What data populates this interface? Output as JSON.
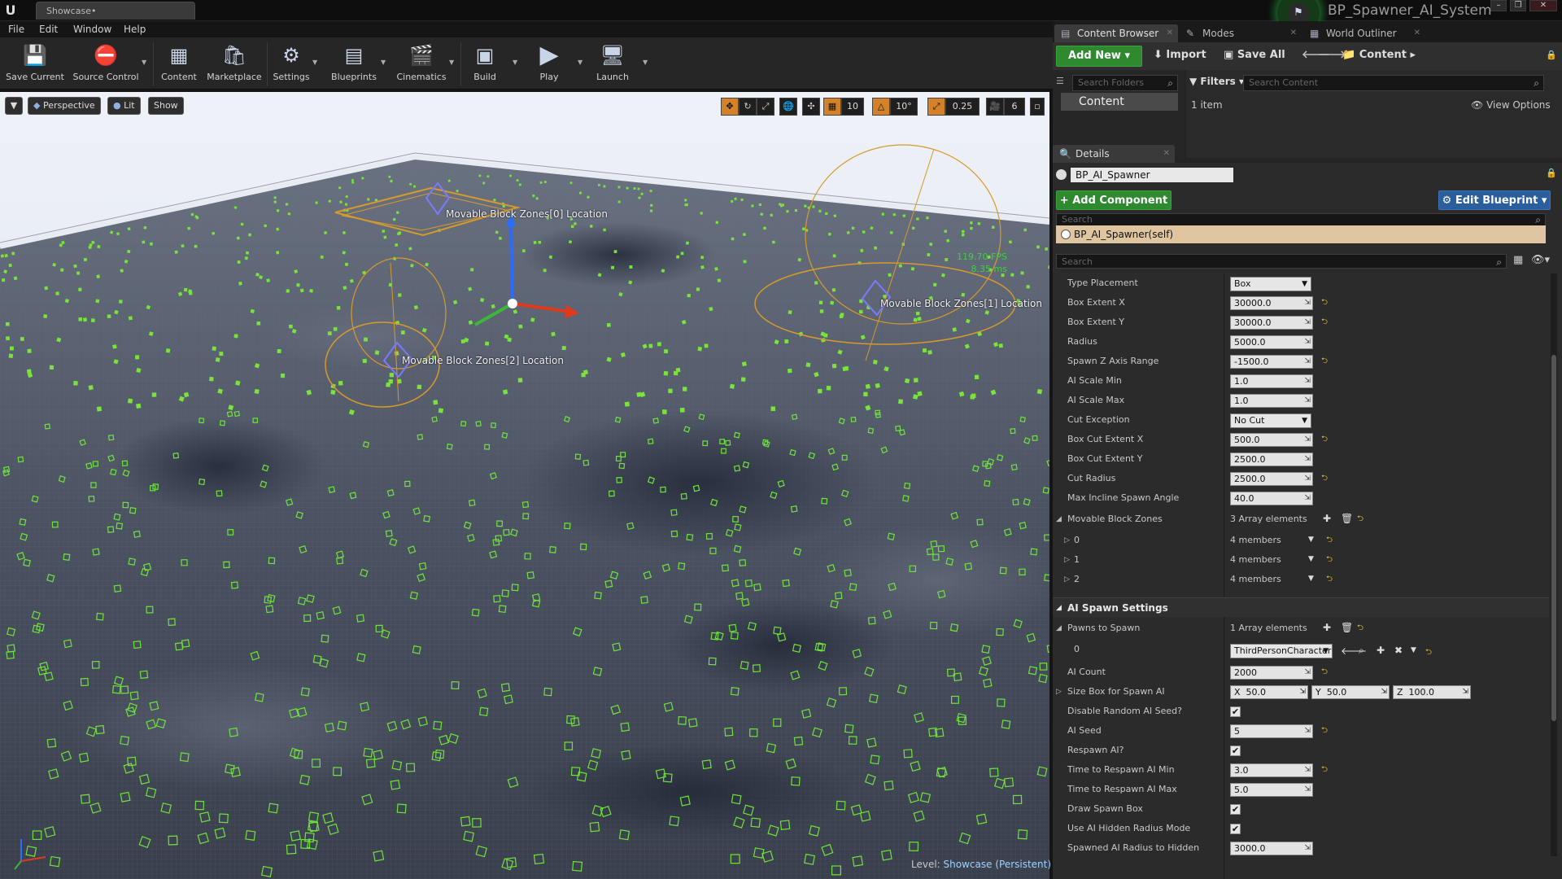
{
  "window": {
    "tab_title": "Showcase•",
    "project_name": "BP_Spawner_AI_System"
  },
  "menu": [
    "File",
    "Edit",
    "Window",
    "Help"
  ],
  "toolbar": {
    "save_current": "Save Current",
    "source_control": "Source Control",
    "content": "Content",
    "marketplace": "Marketplace",
    "settings": "Settings",
    "blueprints": "Blueprints",
    "cinematics": "Cinematics",
    "build": "Build",
    "play": "Play",
    "launch": "Launch"
  },
  "viewport": {
    "perspective": "Perspective",
    "lit": "Lit",
    "show": "Show",
    "grid_snap": "10",
    "rot_snap": "10°",
    "scale_snap": "0.25",
    "cam_speed": "6",
    "fps": "119.70 FPS",
    "ms": "8.35 ms",
    "labels": {
      "zone0": "Movable Block Zones[0] Location",
      "zone1": "Movable Block Zones[1] Location",
      "zone2": "Movable Block Zones[2] Location"
    },
    "level_label": "Level:",
    "level_name": "Showcase (Persistent)"
  },
  "panel_tabs": [
    "Content Browser",
    "Modes",
    "World Outliner"
  ],
  "content_browser": {
    "add_new": "Add New",
    "import": "Import",
    "save_all": "Save All",
    "path": "Content",
    "search_folders": "Search Folders",
    "filters": "Filters",
    "search_content": "Search Content",
    "folder": "Content",
    "item_count": "1 item",
    "view_options": "View Options"
  },
  "details": {
    "tab": "Details",
    "actor_name": "BP_AI_Spawner",
    "add_component": "+ Add Component",
    "edit_blueprint": "Edit Blueprint",
    "search": "Search",
    "self_row": "BP_AI_Spawner(self)",
    "search2": "Search",
    "properties": [
      {
        "label": "Type Placement",
        "value": "Box"
      },
      {
        "label": "Box Extent X",
        "value": "30000.0"
      },
      {
        "label": "Box Extent Y",
        "value": "30000.0"
      },
      {
        "label": "Radius",
        "value": "5000.0"
      },
      {
        "label": "Spawn Z Axis Range",
        "value": "-1500.0"
      },
      {
        "label": "AI Scale Min",
        "value": "1.0"
      },
      {
        "label": "AI Scale Max",
        "value": "1.0"
      },
      {
        "label": "Cut Exception",
        "value": "No Cut"
      },
      {
        "label": "Box Cut Extent X",
        "value": "500.0"
      },
      {
        "label": "Box Cut Extent Y",
        "value": "2500.0"
      },
      {
        "label": "Cut Radius",
        "value": "2500.0"
      },
      {
        "label": "Max Incline Spawn Angle",
        "value": "40.0"
      }
    ],
    "movable_block_zones": {
      "label": "Movable Block Zones",
      "count": "3 Array elements",
      "items": [
        {
          "index": "0",
          "value": "4 members"
        },
        {
          "index": "1",
          "value": "4 members"
        },
        {
          "index": "2",
          "value": "4 members"
        }
      ]
    },
    "ai_spawn_settings": {
      "title": "AI Spawn Settings",
      "pawns_label": "Pawns to Spawn",
      "pawns_count": "1 Array elements",
      "pawn_index": "0",
      "pawn_value": "ThirdPersonCharacter",
      "ai_count_label": "AI Count",
      "ai_count": "2000",
      "size_box_label": "Size Box for Spawn AI",
      "size_x": "50.0",
      "size_y": "50.0",
      "size_z": "100.0",
      "disable_seed_label": "Disable Random AI Seed?",
      "ai_seed_label": "AI Seed",
      "ai_seed": "5",
      "respawn_label": "Respawn AI?",
      "respawn_min_label": "Time to Respawn AI Min",
      "respawn_min": "3.0",
      "respawn_max_label": "Time to Respawn AI Max",
      "respawn_max": "5.0",
      "draw_box_label": "Draw Spawn Box",
      "hidden_radius_mode_label": "Use AI Hidden Radius Mode",
      "spawned_radius_label": "Spawned AI Radius to Hidden",
      "spawned_radius": "3000.0"
    }
  }
}
